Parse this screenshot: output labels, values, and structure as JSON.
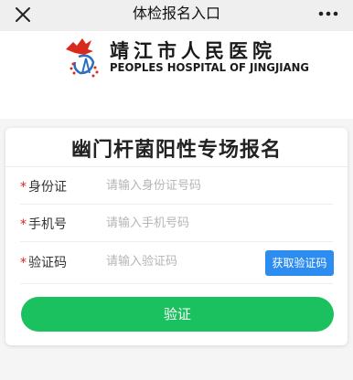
{
  "topbar": {
    "title": "体检报名入口",
    "close_icon": "close-icon",
    "more_icon": "more-dots-icon"
  },
  "header": {
    "hospital_cn": "靖江市人民医院",
    "hospital_en": "PEOPLES HOSPITAL OF JINGJIANG"
  },
  "form": {
    "title": "幽门杆菌阳性专场报名",
    "required_mark": "*",
    "id_label": "身份证",
    "id_placeholder": "请输入身份证号码",
    "phone_label": "手机号",
    "phone_placeholder": "请输入手机号码",
    "code_label": "验证码",
    "code_placeholder": "请输入验证码",
    "get_code_label": "获取验证码",
    "verify_label": "验证"
  },
  "colors": {
    "accent_blue": "#2d8cf0",
    "accent_green": "#1bc15e",
    "required_red": "#e02020",
    "logo_red": "#d9281c"
  }
}
